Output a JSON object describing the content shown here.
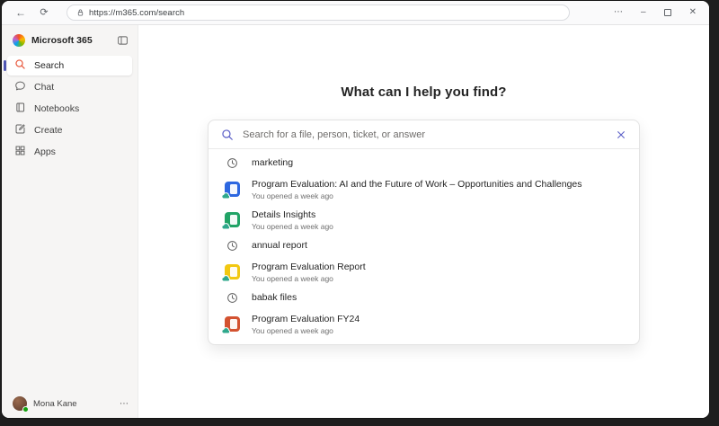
{
  "browser": {
    "url": "https://m365.com/search",
    "back_icon": "←",
    "reload_icon": "⟳",
    "menu_icon": "⋯",
    "minimize_icon": "–",
    "close_icon": "✕"
  },
  "sidebar": {
    "brand": "Microsoft 365",
    "items": [
      {
        "label": "Search",
        "icon": "search",
        "selected": true
      },
      {
        "label": "Chat",
        "icon": "chat",
        "selected": false
      },
      {
        "label": "Notebooks",
        "icon": "notebooks",
        "selected": false
      },
      {
        "label": "Create",
        "icon": "create",
        "selected": false
      },
      {
        "label": "Apps",
        "icon": "apps",
        "selected": false
      }
    ],
    "user": {
      "name": "Mona Kane",
      "more_icon": "⋯"
    }
  },
  "main": {
    "heading": "What can I help you find?",
    "search": {
      "placeholder": "Search for a file, person, ticket, or answer",
      "value": ""
    },
    "suggestions": [
      {
        "type": "history",
        "title": "marketing",
        "subtitle": ""
      },
      {
        "type": "word",
        "title": "Program Evaluation: AI and the Future of Work – Opportunities and Challenges",
        "subtitle": "You opened a week ago"
      },
      {
        "type": "excel",
        "title": "Details Insights",
        "subtitle": "You opened a week ago"
      },
      {
        "type": "history",
        "title": "annual report",
        "subtitle": ""
      },
      {
        "type": "yellow",
        "title": "Program Evaluation Report",
        "subtitle": "You opened a week ago"
      },
      {
        "type": "history",
        "title": "babak files",
        "subtitle": ""
      },
      {
        "type": "powerpoint",
        "title": "Program Evaluation FY24",
        "subtitle": "You opened a week ago"
      }
    ]
  },
  "colors": {
    "accent": "#5b5fc7",
    "selected_bar": "#4f56b3",
    "word_blue": "#2d67e0",
    "excel_green": "#21a366",
    "powerpoint_red": "#d35230",
    "yellow_doc": "#f2c811",
    "presence_green": "#13a10e",
    "sidebar_search_icon": "#e8583d",
    "cloud_badge": "#2fa88c"
  }
}
